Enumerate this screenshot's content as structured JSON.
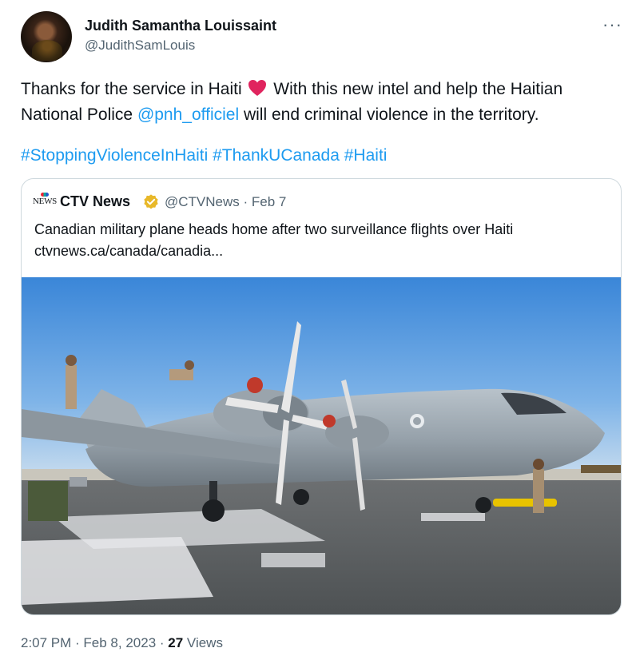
{
  "author": {
    "name": "Judith Samantha Louissaint",
    "handle": "@JudithSamLouis"
  },
  "tweet": {
    "text_part1": "Thanks for the service in Haiti",
    "text_part2": "With this new intel and help the Haitian National Police",
    "mention": "@pnh_officiel",
    "text_part3": "will end criminal violence in the territory.",
    "hashtags": [
      "#StoppingViolenceInHaiti",
      "#ThankUCanada",
      "#Haiti"
    ]
  },
  "more_icon": "more-horizontal-icon",
  "heart_icon": "red-heart-emoji",
  "heart_color": "#e0245e",
  "link_color": "#1d9bf0",
  "quoted": {
    "logo_text": "NEWS",
    "name": "CTV News",
    "handle_date": "@CTVNews · Feb 7",
    "headline": "Canadian military plane heads home after two surveillance flights over Haiti",
    "url": "ctvnews.ca/canada/canadia..."
  },
  "footer": {
    "time_date": "2:07 PM · Feb 8, 2023 · ",
    "views_count": "27",
    "views_label": " Views"
  }
}
